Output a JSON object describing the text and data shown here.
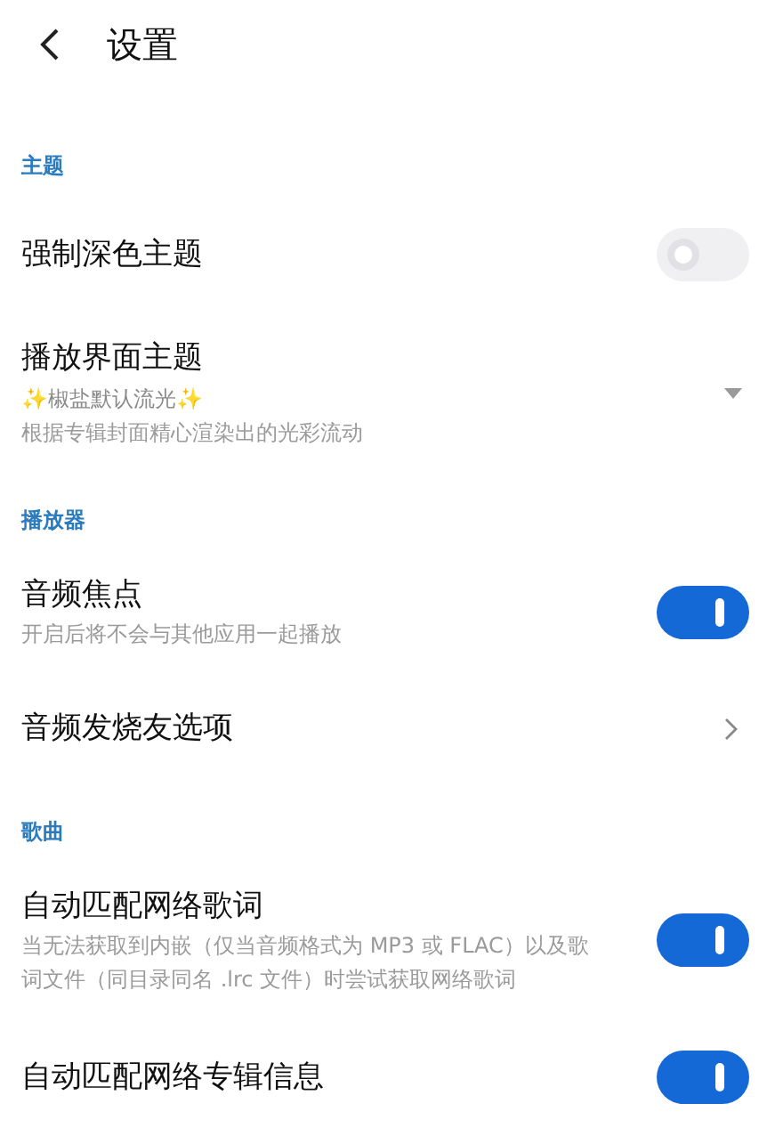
{
  "header": {
    "title": "设置"
  },
  "sections": [
    {
      "title": "主题",
      "items": [
        {
          "kind": "toggle",
          "label": "强制深色主题",
          "on": false
        },
        {
          "kind": "dropdown",
          "label": "播放界面主题",
          "value": "✨椒盐默认流光✨",
          "description": "根据专辑封面精心渲染出的光彩流动"
        }
      ]
    },
    {
      "title": "播放器",
      "items": [
        {
          "kind": "toggle",
          "label": "音频焦点",
          "description": "开启后将不会与其他应用一起播放",
          "on": true
        },
        {
          "kind": "link",
          "label": "音频发烧友选项"
        }
      ]
    },
    {
      "title": "歌曲",
      "items": [
        {
          "kind": "toggle",
          "label": "自动匹配网络歌词",
          "description": "当无法获取到内嵌（仅当音频格式为 MP3 或 FLAC）以及歌词文件（同目录同名 .lrc 文件）时尝试获取网络歌词",
          "on": true
        },
        {
          "kind": "toggle",
          "label": "自动匹配网络专辑信息",
          "on": true
        }
      ]
    }
  ]
}
